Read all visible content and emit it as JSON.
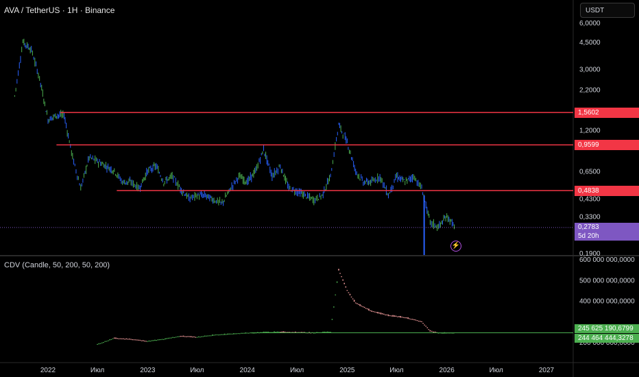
{
  "header": {
    "symbol_title": "AVA / TetherUS · 1H · Binance"
  },
  "currency_button": {
    "label": "USDT"
  },
  "indicator": {
    "title": "CDV (Candle, 50, 200, 50, 200)"
  },
  "price_axis": {
    "scale": "log",
    "range": [
      0.19,
      6.0
    ],
    "ticks": [
      {
        "value": 6.0,
        "label": "6,0000"
      },
      {
        "value": 4.5,
        "label": "4,5000"
      },
      {
        "value": 3.0,
        "label": "3,0000"
      },
      {
        "value": 2.2,
        "label": "2,2000"
      },
      {
        "value": 1.2,
        "label": "1,2000"
      },
      {
        "value": 0.65,
        "label": "0,6500"
      },
      {
        "value": 0.43,
        "label": "0,4300"
      },
      {
        "value": 0.33,
        "label": "0,3300"
      },
      {
        "value": 0.19,
        "label": "0,1900"
      }
    ]
  },
  "cdv_axis": {
    "ticks": [
      {
        "value": 600000000,
        "label": "600 000 000,0000"
      },
      {
        "value": 500000000,
        "label": "500 000 000,0000"
      },
      {
        "value": 400000000,
        "label": "400 000 000,0000"
      },
      {
        "value": 200000000,
        "label": "200 000 000,0000"
      }
    ]
  },
  "time_axis": {
    "labels": [
      {
        "label": "2022",
        "date": "2022-01-01"
      },
      {
        "label": "Июл",
        "date": "2022-07-01"
      },
      {
        "label": "2023",
        "date": "2023-01-01"
      },
      {
        "label": "Июл",
        "date": "2023-07-01"
      },
      {
        "label": "2024",
        "date": "2024-01-01"
      },
      {
        "label": "Июл",
        "date": "2024-07-01"
      },
      {
        "label": "2025",
        "date": "2025-01-01"
      },
      {
        "label": "Июл",
        "date": "2025-07-01"
      },
      {
        "label": "2026",
        "date": "2026-01-01"
      },
      {
        "label": "Июл",
        "date": "2026-07-01"
      },
      {
        "label": "2027",
        "date": "2027-01-01"
      }
    ]
  },
  "horizontal_levels": [
    {
      "value": 1.5602,
      "label": "1,5602",
      "color": "#f23645"
    },
    {
      "value": 0.9599,
      "label": "0,9599",
      "color": "#f23645"
    },
    {
      "value": 0.4838,
      "label": "0,4838",
      "color": "#f23645"
    }
  ],
  "current_price": {
    "value": 0.2783,
    "label": "0,2783",
    "countdown": "5d 20h",
    "color": "#7e57c2"
  },
  "cdv_labels": [
    {
      "value": 245625190.6799,
      "label": "245 625 190,6799",
      "color": "#4caf50"
    },
    {
      "value": 244464444.3278,
      "label": "244 464 444,3278",
      "color": "#4caf50"
    }
  ],
  "colors": {
    "up": "#4caf50",
    "down": "#2962ff",
    "cdv_up": "#4caf50",
    "cdv_down": "#ef9a9a",
    "level": "#f23645"
  },
  "chart_data": {
    "type": "candlestick",
    "series": [
      {
        "name": "AVA / TetherUS",
        "kind": "price",
        "x": [
          "2021-09",
          "2021-10",
          "2021-11",
          "2021-12",
          "2022-01",
          "2022-02",
          "2022-03",
          "2022-04",
          "2022-05",
          "2022-06",
          "2022-07",
          "2022-08",
          "2022-09",
          "2022-10",
          "2022-11",
          "2022-12",
          "2023-01",
          "2023-02",
          "2023-03",
          "2023-04",
          "2023-05",
          "2023-06",
          "2023-07",
          "2023-08",
          "2023-09",
          "2023-10",
          "2023-11",
          "2023-12",
          "2024-01",
          "2024-02",
          "2024-03",
          "2024-04",
          "2024-05",
          "2024-06",
          "2024-07",
          "2024-08",
          "2024-09",
          "2024-10",
          "2024-11",
          "2024-12",
          "2025-01",
          "2025-02",
          "2025-03",
          "2025-04",
          "2025-05",
          "2025-06",
          "2025-07",
          "2025-08",
          "2025-09",
          "2025-10",
          "2025-11",
          "2025-12",
          "2026-01",
          "2026-02"
        ],
        "values": [
          2.0,
          4.5,
          4.0,
          2.6,
          1.4,
          1.5,
          1.5,
          0.8,
          0.5,
          0.8,
          0.75,
          0.7,
          0.65,
          0.55,
          0.55,
          0.5,
          0.65,
          0.7,
          0.55,
          0.6,
          0.5,
          0.43,
          0.45,
          0.45,
          0.42,
          0.4,
          0.5,
          0.6,
          0.55,
          0.65,
          0.9,
          0.6,
          0.7,
          0.5,
          0.48,
          0.45,
          0.42,
          0.45,
          0.6,
          1.3,
          1.0,
          0.65,
          0.55,
          0.55,
          0.6,
          0.45,
          0.6,
          0.55,
          0.6,
          0.5,
          0.3,
          0.28,
          0.33,
          0.2783
        ]
      },
      {
        "name": "CDV",
        "kind": "cdv",
        "x": [
          "2022-07",
          "2022-09",
          "2022-11",
          "2023-01",
          "2023-03",
          "2023-05",
          "2023-07",
          "2023-09",
          "2023-11",
          "2024-01",
          "2024-03",
          "2024-05",
          "2024-07",
          "2024-09",
          "2024-11",
          "2024-12",
          "2025-01",
          "2025-02",
          "2025-04",
          "2025-06",
          "2025-08",
          "2025-10",
          "2025-11",
          "2025-12",
          "2026-02"
        ],
        "values": [
          190000000,
          220000000,
          215000000,
          205000000,
          215000000,
          230000000,
          225000000,
          235000000,
          240000000,
          245000000,
          248000000,
          250000000,
          248000000,
          246000000,
          250000000,
          550000000,
          450000000,
          390000000,
          350000000,
          330000000,
          320000000,
          300000000,
          255000000,
          245000000,
          245625190.68
        ]
      }
    ]
  }
}
